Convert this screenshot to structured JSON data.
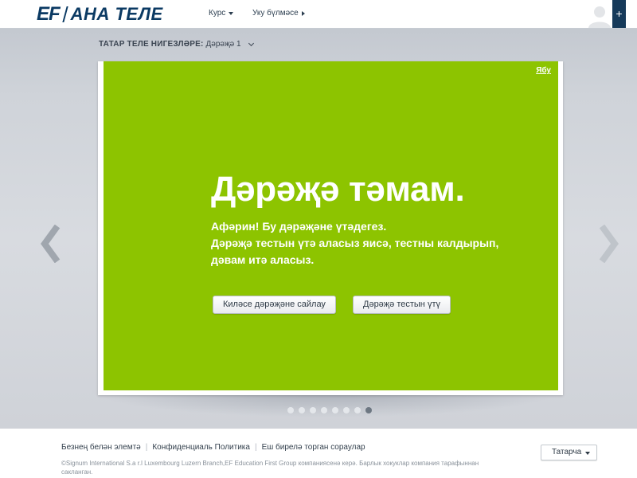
{
  "header": {
    "logo_ef": "EF",
    "logo_name": "АНА ТЕЛЕ",
    "nav": [
      {
        "label": "Курс"
      },
      {
        "label": "Уку бүлмәсе"
      }
    ],
    "plus": "+"
  },
  "level": {
    "label": "ТАТАР ТЕЛЕ НИГЕЗЛӘРЕ:",
    "value": "Дәрәҗә 1"
  },
  "card": {
    "skip": "Ябу",
    "title": "Дәрәҗә тәмам.",
    "message_lines": [
      "Афәрин! Бу дәрәҗәне үтәдегез.",
      "Дәрәҗә тестын үтә аласыз яисә, тестны калдырып,",
      "дәвам итә аласыз."
    ],
    "btn_choose_next": "Киләсе дәрәҗәне сайлау",
    "btn_take_test": "Дәрәҗә тестын үтү",
    "bg_color": "#8dc400"
  },
  "pager": {
    "count": 8,
    "active_index": 7
  },
  "footer": {
    "links": [
      {
        "label": "Безнең белән элемтә"
      },
      {
        "label": "Конфиденциаль Политика"
      },
      {
        "label": "Еш бирелә торган сораулар"
      }
    ],
    "copyright": "©Signum International S.a r.l Luxembourg Luzern Branch,EF Education First Group компаниясенә керә. Барлык хокуклар компания тарафыннан сакланган.",
    "language": "Татарча"
  },
  "colors": {
    "brand": "#0b3a63",
    "accent": "#8dc400"
  }
}
